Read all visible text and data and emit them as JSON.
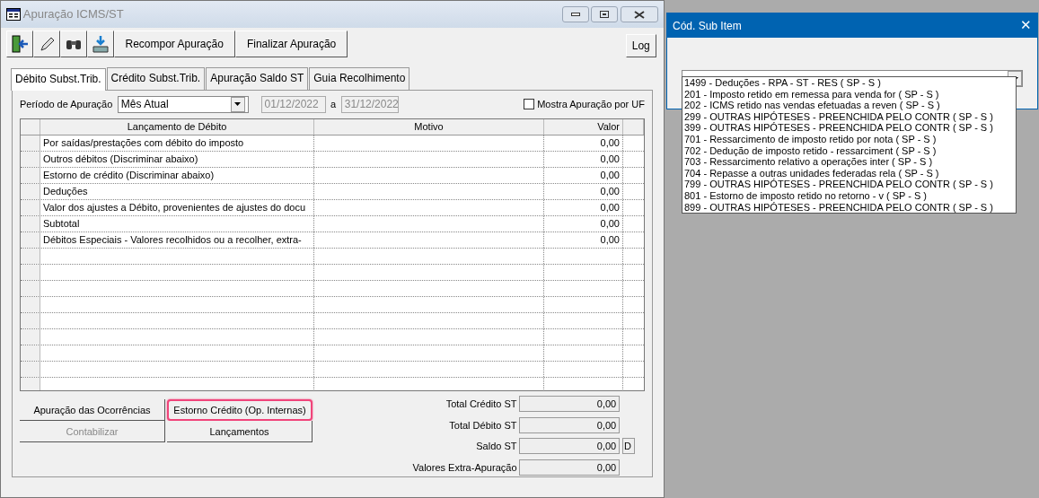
{
  "window": {
    "title": "Apuração ICMS/ST"
  },
  "toolbar": {
    "buttons": [
      "Recompor Apuração",
      "Finalizar Apuração"
    ],
    "log_button": "Log"
  },
  "tabs": [
    {
      "label": "Débito Subst.Trib.",
      "selected": true
    },
    {
      "label": "Crédito Subst.Trib.",
      "selected": false
    },
    {
      "label": "Apuração Saldo ST",
      "selected": false
    },
    {
      "label": "Guia Recolhimento",
      "selected": false
    }
  ],
  "period": {
    "label": "Período de  Apuração",
    "value": "Mês Atual",
    "start": "01/12/2022",
    "separator": "a",
    "end": "31/12/2022"
  },
  "show_by_uf": {
    "label": "Mostra Apuração por UF",
    "checked": false
  },
  "table": {
    "columns": [
      "Lançamento de Débito",
      "Motivo",
      "Valor"
    ],
    "rows": [
      {
        "entry": "Por saídas/prestações com débito do imposto",
        "value": "0,00"
      },
      {
        "entry": "Outros débitos (Discriminar abaixo)",
        "value": "0,00"
      },
      {
        "entry": "Estorno de crédito (Discriminar abaixo)",
        "value": "0,00"
      },
      {
        "entry": "Deduções",
        "value": "0,00"
      },
      {
        "entry": "Valor dos ajustes a Débito, provenientes de ajustes do docu",
        "value": "0,00"
      },
      {
        "entry": "Subtotal",
        "value": "0,00"
      },
      {
        "entry": "Débitos Especiais - Valores recolhidos ou a recolher, extra-",
        "value": "0,00"
      }
    ]
  },
  "action_buttons": [
    {
      "label": "Apuração das Ocorrências",
      "disabled": false,
      "highlighted": false
    },
    {
      "label": "Estorno Crédito (Op. Internas)",
      "disabled": false,
      "highlighted": true
    },
    {
      "label": "Contabilizar",
      "disabled": true,
      "highlighted": false
    },
    {
      "label": "Lançamentos",
      "disabled": false,
      "highlighted": false
    }
  ],
  "totals": [
    {
      "label": "Total Crédito ST",
      "value": "0,00"
    },
    {
      "label": "Total Débito ST",
      "value": "0,00"
    },
    {
      "label": "Saldo ST",
      "value": "0,00",
      "flag": "D"
    },
    {
      "label": "Valores Extra-Apuração",
      "value": "0,00"
    }
  ],
  "dialog": {
    "title": "Cód. Sub Item",
    "close": "✕",
    "options": [
      "1499 - Deduções - RPA - ST - RES ( SP - S )",
      "201 - Imposto retido em remessa para venda for ( SP - S )",
      "202 - ICMS retido nas vendas efetuadas a reven ( SP - S )",
      "299 - OUTRAS HIPÓTESES - PREENCHIDA PELO CONTR ( SP - S )",
      "399 - OUTRAS HIPÓTESES - PREENCHIDA PELO CONTR ( SP - S )",
      "701 - Ressarcimento de imposto retido por nota ( SP - S )",
      "702 - Dedução de imposto retido - ressarciment ( SP - S )",
      "703 - Ressarcimento relativo a operações inter ( SP - S )",
      "704 - Repasse a outras unidades federadas rela ( SP - S )",
      "799 - OUTRAS HIPÓTESES - PREENCHIDA PELO CONTR ( SP - S )",
      "801 - Estorno de imposto retido no retorno - v ( SP - S )",
      "899 - OUTRAS HIPÓTESES - PREENCHIDA PELO CONTR ( SP - S )"
    ]
  }
}
